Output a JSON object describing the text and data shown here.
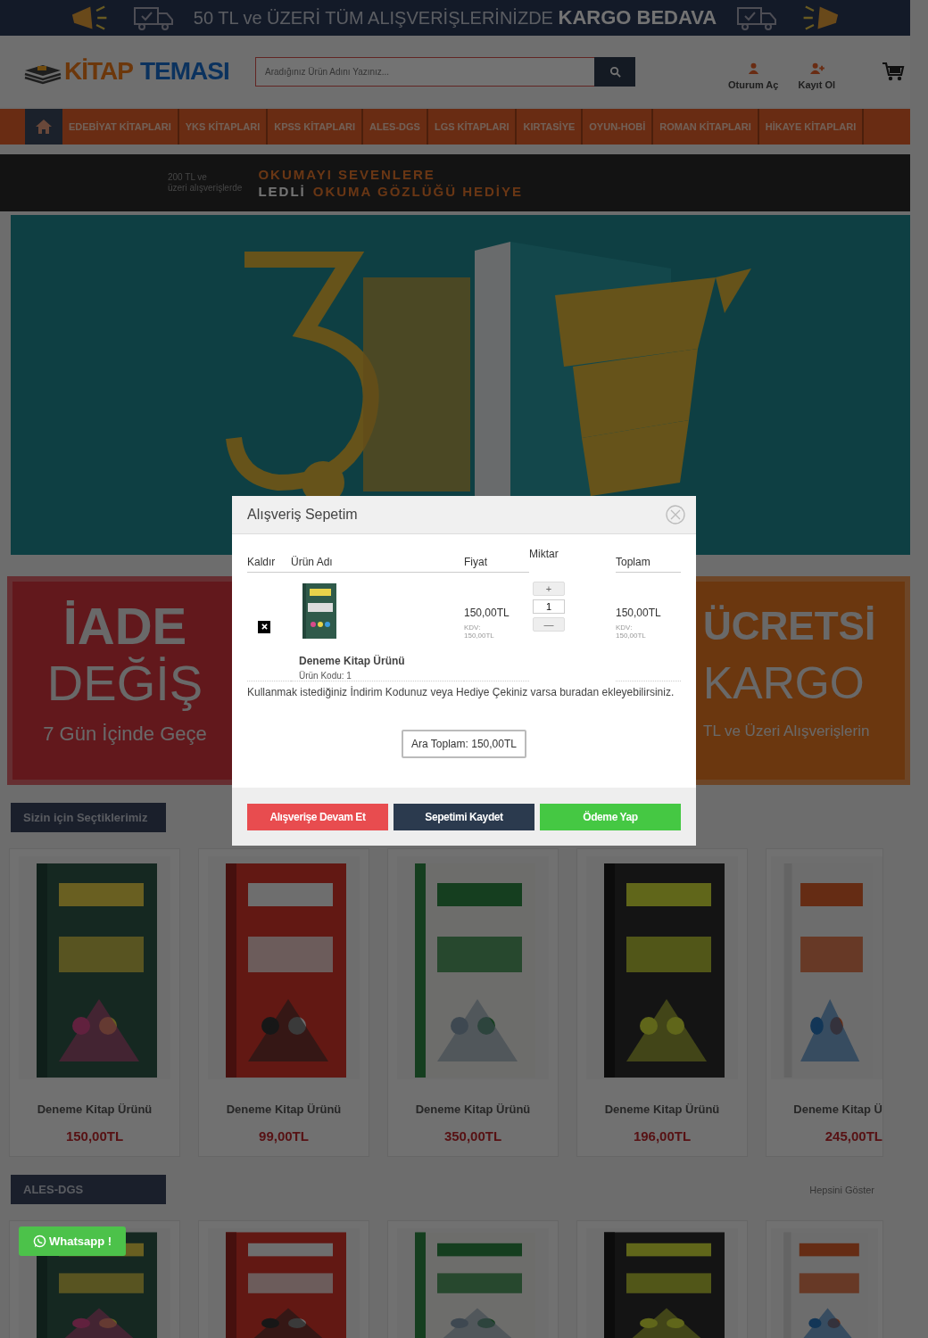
{
  "top_banner": {
    "text": "50 TL ve ÜZERİ TÜM ALIŞVERİŞLERİNİZDE **KARGO BEDAVA**"
  },
  "logo": {
    "part1": "KİTAP",
    "part2": "TEMASI"
  },
  "search": {
    "placeholder": "Aradığınız Ürün Adını Yazınız..."
  },
  "account_links": [
    {
      "label": "Oturum Aç",
      "kind": "login"
    },
    {
      "label": "Kayıt Ol",
      "kind": "register"
    }
  ],
  "nav": [
    "EDEBİYAT KİTAPLARI",
    "YKS KİTAPLARI",
    "KPSS KİTAPLARI",
    "ALES-DGS",
    "LGS KİTAPLARI",
    "KIRTASİYE",
    "OYUN-HOBİ",
    "ROMAN KİTAPLARI",
    "HİKAYE KİTAPLARI"
  ],
  "promo_strip": {
    "note": [
      "200 TL ve",
      "üzeri alışverişlerde"
    ],
    "line1": "OKUMAYI SEVENLERE",
    "highlight": "LEDLİ",
    "line2": "OKUMA GÖZLÜĞÜ HEDİYE"
  },
  "promo_banners": [
    {
      "lines": [
        "İADE",
        "DEĞİŞ",
        "7  Gün İçinde Geçe"
      ]
    },
    {
      "lines": [
        "ÜCRETSİ",
        "KARGO",
        "TL ve Üzeri Alışverişlerin"
      ]
    }
  ],
  "sections": [
    {
      "title": "Sizin için Seçtiklerimiz",
      "products": [
        {
          "name": "Deneme Kitap Ürünü",
          "price": "150,00TL"
        },
        {
          "name": "Deneme Kitap Ürünü",
          "price": "99,00TL"
        },
        {
          "name": "Deneme Kitap Ürünü",
          "price": "350,00TL"
        },
        {
          "name": "Deneme Kitap Ürünü",
          "price": "196,00TL"
        },
        {
          "name": "Deneme Kitap Ü",
          "price": "245,00TL"
        }
      ]
    },
    {
      "title": "ALES-DGS",
      "link": "Hepsini Göster"
    }
  ],
  "whatsapp": {
    "label": "Whatsapp !"
  },
  "cart_modal": {
    "title": "Alışveriş Sepetim",
    "columns": [
      "Kaldır",
      "Ürün Adı",
      "Fiyat",
      "Miktar",
      "Toplam"
    ],
    "items": [
      {
        "name": "Deneme Kitap Ürünü",
        "code": "Ürün Kodu: 1",
        "price": "150,00TL",
        "tax_label": "KDV:",
        "tax": "150,00TL",
        "increment": "+",
        "quantity": "1",
        "decrement": "—",
        "total": "150,00TL",
        "total_tax_label": "KDV:",
        "total_tax": "150,00TL"
      }
    ],
    "coupon_note": "Kullanmak istediğiniz İndirim Kodunuz veya Hediye Çekiniz varsa buradan ekleyebilirsiniz.",
    "subtotal": "Ara Toplam: 150,00TL",
    "buttons": [
      {
        "label": "Alışverişe Devam Et",
        "kind": "danger"
      },
      {
        "label": "Sepetimi Kaydet",
        "kind": "dark"
      },
      {
        "label": "Ödeme Yap",
        "kind": "success"
      }
    ]
  }
}
